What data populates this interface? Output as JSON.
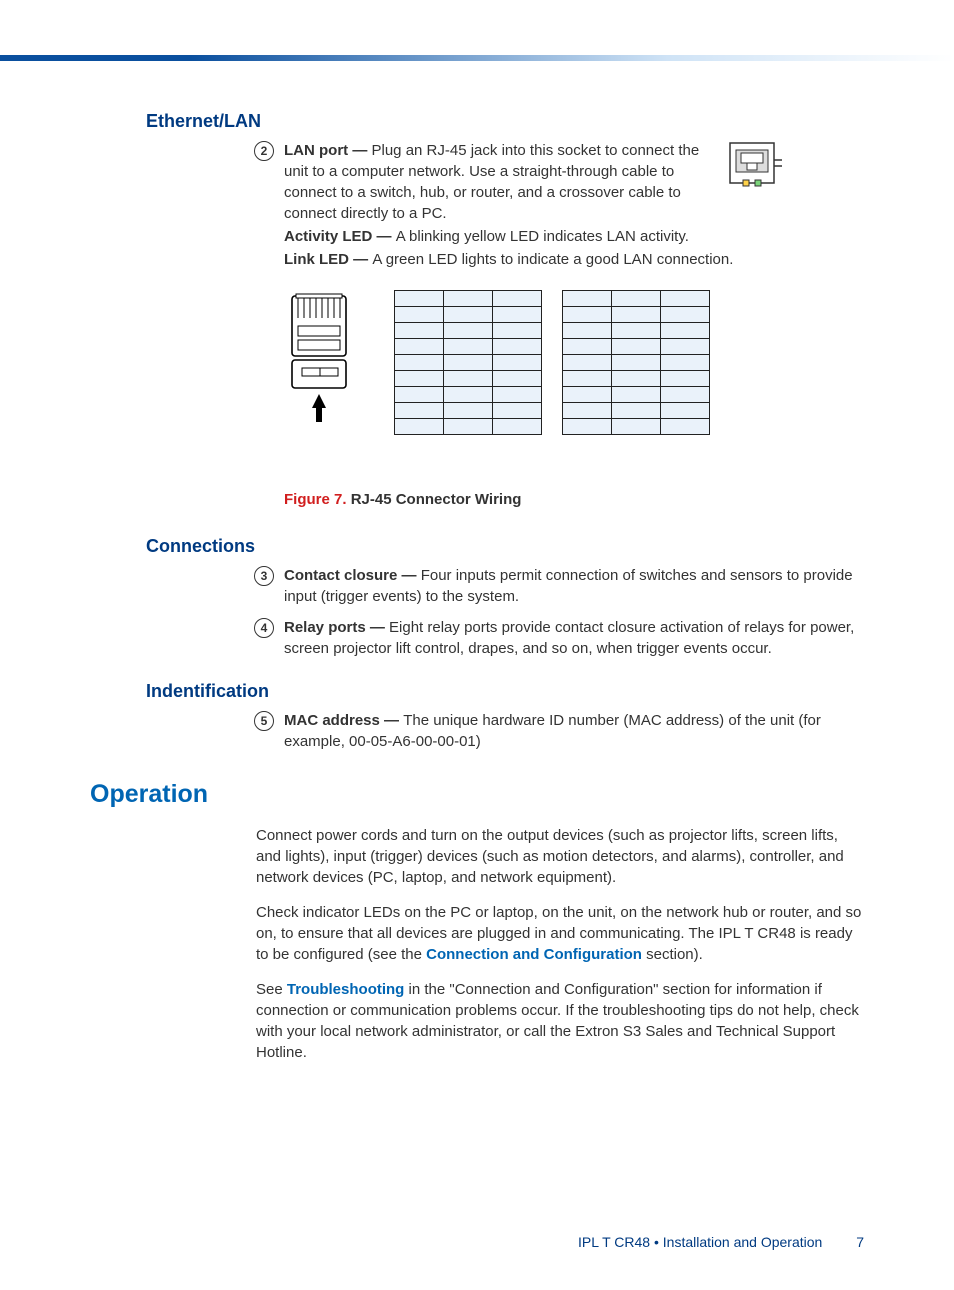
{
  "headings": {
    "ethernet": "Ethernet/LAN",
    "connections": "Connections",
    "identification": "Indentification",
    "operation": "Operation"
  },
  "ethernet": {
    "num": "2",
    "lan_port_label": "LAN port — ",
    "lan_port_text": "Plug an RJ-45 jack into this socket to connect the unit to a computer network. Use a straight-through cable to connect to a switch, hub, or router, and a crossover cable to connect directly to a PC.",
    "activity_led_label": "Activity LED — ",
    "activity_led_text": "A blinking yellow LED indicates LAN activity.",
    "link_led_label": "Link LED — ",
    "link_led_text": "A green LED lights to indicate a good LAN connection."
  },
  "figure": {
    "num": "Figure 7.",
    "title": "RJ-45 Connector Wiring"
  },
  "connections": {
    "contact": {
      "num": "3",
      "label": "Contact closure — ",
      "text": "Four inputs permit connection of switches and sensors to provide input (trigger events) to the system."
    },
    "relay": {
      "num": "4",
      "label": "Relay ports — ",
      "text": "Eight relay ports provide contact closure activation of relays for power, screen projector lift control, drapes, and so on, when trigger events occur."
    }
  },
  "identification": {
    "mac": {
      "num": "5",
      "label": "MAC address — ",
      "text": "The unique hardware ID number (MAC address) of the unit (for example, 00-05-A6-00-00-01)"
    }
  },
  "operation": {
    "p1": "Connect power cords and turn on the output devices (such as projector lifts, screen lifts, and lights), input (trigger) devices (such as motion detectors, and alarms), controller, and network devices (PC, laptop, and network equipment).",
    "p2a": "Check indicator LEDs on the PC or laptop, on the unit, on the network hub or router, and so on, to ensure that all devices are plugged in and communicating. The IPL T CR48 is ready to be configured (see the ",
    "p2_link": "Connection and Configuration",
    "p2b": " section).",
    "p3a": "See ",
    "p3_link": "Troubleshooting",
    "p3b": " in the \"Connection and Configuration\" section for information if connection or communication problems occur. If the troubleshooting tips do not help, check with your local network administrator, or call the Extron S3 Sales and Technical Support Hotline."
  },
  "footer": {
    "text": "IPL T CR48 • Installation and Operation",
    "page": "7"
  }
}
